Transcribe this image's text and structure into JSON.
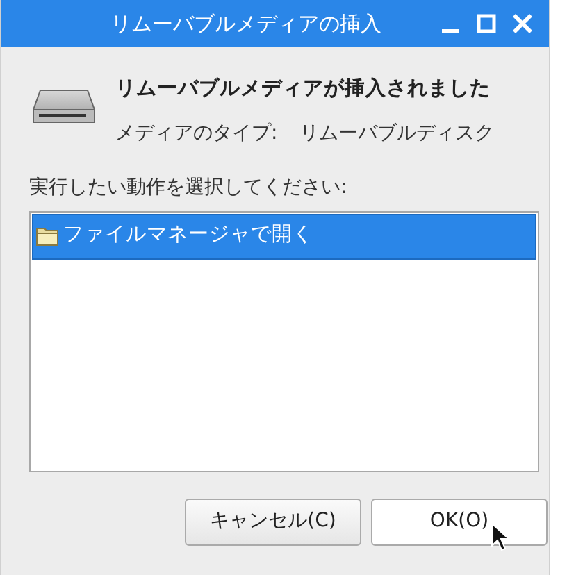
{
  "window": {
    "title": "リムーバブルメディアの挿入"
  },
  "heading": "リムーバブルメディアが挿入されました",
  "media_type": {
    "label": "メディアのタイプ:",
    "value": "リムーバブルディスク"
  },
  "prompt": "実行したい動作を選択してください:",
  "actions": [
    {
      "label": "ファイルマネージャで開く",
      "selected": true
    }
  ],
  "buttons": [
    {
      "label": "キャンセル(C)",
      "kind": "cancel"
    },
    {
      "label": "OK(O)",
      "kind": "ok"
    }
  ]
}
